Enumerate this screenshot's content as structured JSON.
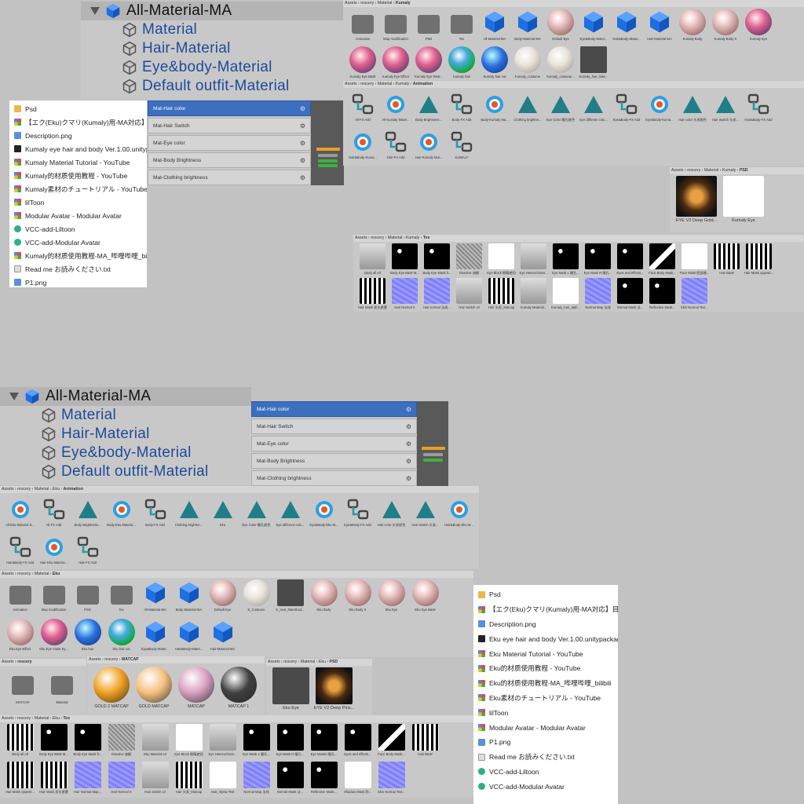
{
  "top_hierarchy": {
    "root": "All-Material-MA",
    "children": [
      "Material",
      "Hair-Material",
      "Eye&body-Material",
      "Default outfit-Material"
    ]
  },
  "bottom_hierarchy": {
    "root": "All-Material-MA",
    "children": [
      "Material",
      "Hair-Material",
      "Eye&body-Material",
      "Default outfit-Material"
    ]
  },
  "top_animator": {
    "params": [
      "Mat-Hair color",
      "Mat-Hair Switch",
      "Mat-Eye color",
      "Mat-Body Brightness",
      "Mat-Clothing brightness"
    ]
  },
  "bottom_animator": {
    "params": [
      "Mat-Hair color",
      "Mat-Hair Switch",
      "Mat-Eye color",
      "Mat-Body Brightness",
      "Mat-Clothing brightness"
    ]
  },
  "top_files": {
    "items": [
      {
        "icon": "folder",
        "label": "Psd"
      },
      {
        "icon": "web",
        "label": "【エク(Eku)クマリ(Kumaly)用-MA対応】目・..."
      },
      {
        "icon": "img",
        "label": "Description.png"
      },
      {
        "icon": "pkg",
        "label": "Kumaly eye hair and body Ver.1.00.unitypa..."
      },
      {
        "icon": "web",
        "label": "Kumaly Material Tutorial - YouTube"
      },
      {
        "icon": "web",
        "label": "Kumaly的材质使用教程 - YouTube"
      },
      {
        "icon": "web",
        "label": "Kumaly素材のチュートリアル - YouTube"
      },
      {
        "icon": "web",
        "label": "lilToon"
      },
      {
        "icon": "web",
        "label": "Modular Avatar - Modular Avatar"
      },
      {
        "icon": "vcc",
        "label": "VCC-add-Liltoon"
      },
      {
        "icon": "vcc",
        "label": "VCC-add-Modular Avatar"
      },
      {
        "icon": "web",
        "label": "Kumaly的材质使用教程-MA_哔哩哔哩_bilibili"
      },
      {
        "icon": "txt",
        "label": "Read me お読みください.txt"
      },
      {
        "icon": "img",
        "label": "P1.png"
      }
    ]
  },
  "bottom_files": {
    "items": [
      {
        "icon": "folder",
        "label": "Psd"
      },
      {
        "icon": "web",
        "label": "【エク(Eku)クマリ(Kumaly)用-MA対応】目・"
      },
      {
        "icon": "img",
        "label": "Description.png"
      },
      {
        "icon": "pkg",
        "label": "Eku eye hair and body Ver.1.00.unitypackag"
      },
      {
        "icon": "web",
        "label": "Eku Material Tutorial - YouTube"
      },
      {
        "icon": "web",
        "label": "Eku的材质使用教程 - YouTube"
      },
      {
        "icon": "web",
        "label": "Eku的材质使用教程-MA_哔哩哔哩_bilibili"
      },
      {
        "icon": "web",
        "label": "Eku素材のチュートリアル - YouTube"
      },
      {
        "icon": "web",
        "label": "lilToon"
      },
      {
        "icon": "web",
        "label": "Modular Avatar - Modular Avatar"
      },
      {
        "icon": "img",
        "label": "P1.png"
      },
      {
        "icon": "txt",
        "label": "Read me お読みください.txt"
      },
      {
        "icon": "vcc",
        "label": "VCC-add-Liltoon"
      },
      {
        "icon": "vcc",
        "label": "VCC-add-Modular Avatar"
      }
    ]
  },
  "kumaly_panel": {
    "path": [
      "Assets",
      "rescery",
      "Material"
    ],
    "current": "Kumaly",
    "items": [
      {
        "t": "folder",
        "c": "Animation"
      },
      {
        "t": "folder",
        "c": "Map modification"
      },
      {
        "t": "folder",
        "c": "PSD"
      },
      {
        "t": "folder",
        "c": "Tex"
      },
      {
        "t": "cube",
        "c": "All-Material-MA"
      },
      {
        "t": "cube",
        "c": "Body-Material-MA"
      },
      {
        "t": "ball",
        "c": "Default Eye"
      },
      {
        "t": "cube",
        "c": "Eye&Body-Mater..."
      },
      {
        "t": "cube",
        "c": "Hair&Body-Mater..."
      },
      {
        "t": "cube",
        "c": "Hair-Material-MA"
      },
      {
        "t": "ball",
        "c": "Kumaly Body"
      },
      {
        "t": "ball",
        "c": "Kumaly Body X"
      },
      {
        "t": "ballp",
        "c": "Kumaly Eye"
      },
      {
        "t": "ballp",
        "c": "Kumaly Eye B&W"
      },
      {
        "t": "ballp",
        "c": "Kumaly Eye Effect"
      },
      {
        "t": "ballp",
        "c": "Kumaly Eye Redr..."
      },
      {
        "t": "ballc",
        "c": "Kumaly hair"
      },
      {
        "t": "ballb",
        "c": "Kumaly hair cut"
      },
      {
        "t": "ballw",
        "c": "Kumaly_costume"
      },
      {
        "t": "ballw",
        "c": "Kumaly_costume..."
      },
      {
        "t": "gray",
        "c": "Kumaly_hair_fake..."
      }
    ]
  },
  "kumaly_anim": {
    "path": [
      "Assets",
      "rescery",
      "Material",
      "Kumaly"
    ],
    "current": "Animation",
    "items": [
      {
        "t": "state",
        "c": "All-FX Add"
      },
      {
        "t": "clip",
        "c": "All-Kumaly Mater..."
      },
      {
        "t": "tri",
        "c": "Body Brightness..."
      },
      {
        "t": "state",
        "c": "Body-FX Add"
      },
      {
        "t": "clip",
        "c": "Body-Kumaly Ma..."
      },
      {
        "t": "tri",
        "c": "Clothing brightne..."
      },
      {
        "t": "tri",
        "c": "Eye Color 瞳孔颜色"
      },
      {
        "t": "tri",
        "c": "Eye different colo..."
      },
      {
        "t": "state",
        "c": "Eye&Body-FX Add"
      },
      {
        "t": "clip",
        "c": "Eye&Body-Kuma..."
      },
      {
        "t": "tri",
        "c": "Hair color 头发颜色"
      },
      {
        "t": "tri",
        "c": "Hair Switch 头发..."
      },
      {
        "t": "state",
        "c": "Hair&Body-FX Add"
      },
      {
        "t": "clip",
        "c": "Hair&Body-Kuma..."
      },
      {
        "t": "state",
        "c": "Hair-FX Add"
      },
      {
        "t": "clip",
        "c": "Hair-Kumaly Mat..."
      },
      {
        "t": "state",
        "c": "KUMALY"
      }
    ]
  },
  "kumaly_psd": {
    "path": [
      "Assets",
      "rescery",
      "Material",
      "Kumaly"
    ],
    "current": "PSD",
    "items": [
      {
        "t": "eye",
        "c": "EYE V2 Deep Gold..."
      },
      {
        "t": "white",
        "c": "Kumaly Eye"
      }
    ]
  },
  "kumaly_tex": {
    "path": [
      "Assets",
      "rescery",
      "Material",
      "Kumaly"
    ],
    "current": "Tex",
    "items": [
      {
        "t": "char",
        "c": "Body all All"
      },
      {
        "t": "black",
        "c": "Body Eye B&W M..."
      },
      {
        "t": "black",
        "c": "Body Eye Mask fr..."
      },
      {
        "t": "noise",
        "c": "Dissolve 溶解"
      },
      {
        "t": "white",
        "c": "Eye Block 眼睛遮挡"
      },
      {
        "t": "char",
        "c": "Eye Heterochrom..."
      },
      {
        "t": "black",
        "c": "Eye Mask L 瞳孔..."
      },
      {
        "t": "black",
        "c": "Eye Mask R 瞳孔..."
      },
      {
        "t": "black",
        "c": "Eyes and effects..."
      },
      {
        "t": "mask",
        "c": "Face Body Mask..."
      },
      {
        "t": "white",
        "c": "Face Mask 脸部遮..."
      },
      {
        "t": "bw",
        "c": "Hair B&W"
      },
      {
        "t": "bw",
        "c": "Hair Mask opposit..."
      },
      {
        "t": "bw",
        "c": "Hair Mask 发光遮罩"
      },
      {
        "t": "normal",
        "c": "Hair Normal X"
      },
      {
        "t": "normal",
        "c": "Hair normal 法线..."
      },
      {
        "t": "char",
        "c": "Hair Switch UI"
      },
      {
        "t": "bw",
        "c": "Hair 头发_Matcap"
      },
      {
        "t": "char",
        "c": "Kumaly Material..."
      },
      {
        "t": "white",
        "c": "Kumaly_hair_alph..."
      },
      {
        "t": "normal",
        "c": "Normal Map 法线"
      },
      {
        "t": "black",
        "c": "Normal Mask 法..."
      },
      {
        "t": "black",
        "c": "Reflective Mask..."
      },
      {
        "t": "normal",
        "c": "Skin Normal Text..."
      }
    ]
  },
  "eku_anim": {
    "path": [
      "Assets",
      "rescery",
      "Material",
      "Eku"
    ],
    "current": "Animation",
    "items": [
      {
        "t": "clip",
        "c": "All-Eku Material S..."
      },
      {
        "t": "state",
        "c": "All-FX Add"
      },
      {
        "t": "tri",
        "c": "Body Brightness..."
      },
      {
        "t": "clip",
        "c": "Body-Eku Materia..."
      },
      {
        "t": "state",
        "c": "Body-FX Add"
      },
      {
        "t": "tri",
        "c": "Clothing brightne..."
      },
      {
        "t": "tri",
        "c": "Eku"
      },
      {
        "t": "tri",
        "c": "Eye Color 瞳孔颜色"
      },
      {
        "t": "tri",
        "c": "Eye different colo..."
      },
      {
        "t": "clip",
        "c": "Eye&Body-Eku M..."
      },
      {
        "t": "state",
        "c": "Eye&Body-FX Add"
      },
      {
        "t": "tri",
        "c": "Hair color 头发颜色"
      },
      {
        "t": "tri",
        "c": "Hair Switch 头发..."
      },
      {
        "t": "clip",
        "c": "Hair&Body-Eku M..."
      },
      {
        "t": "state",
        "c": "Hair&Body-FX Add"
      },
      {
        "t": "clip",
        "c": "Hair-Eku Materia..."
      },
      {
        "t": "state",
        "c": "Hair-FX Add"
      }
    ]
  },
  "eku_panel": {
    "path": [
      "Assets",
      "rescery",
      "Material"
    ],
    "current": "Eku",
    "items": [
      {
        "t": "folder",
        "c": "Animation"
      },
      {
        "t": "folder",
        "c": "Map modification"
      },
      {
        "t": "folder",
        "c": "PSD"
      },
      {
        "t": "folder",
        "c": "Tex"
      },
      {
        "t": "cube",
        "c": "All-Material-MA"
      },
      {
        "t": "cube",
        "c": "Body-Material-MA"
      },
      {
        "t": "ball",
        "c": "Default Eye"
      },
      {
        "t": "ballw",
        "c": "E_Costume"
      },
      {
        "t": "gray",
        "c": "E_Hair_fakeShad..."
      },
      {
        "t": "ball",
        "c": "Eku Body"
      },
      {
        "t": "ball",
        "c": "Eku Body X"
      },
      {
        "t": "ball",
        "c": "Eku Eye"
      },
      {
        "t": "ball",
        "c": "Eku Eye B&W"
      },
      {
        "t": "ball",
        "c": "Eku Eye Effect"
      },
      {
        "t": "ballp",
        "c": "Eku Eye Violet Ey..."
      },
      {
        "t": "ballb",
        "c": "Eku hair"
      },
      {
        "t": "ballc",
        "c": "Eku hair cut"
      },
      {
        "t": "cube",
        "c": "Eye&Body-Mater..."
      },
      {
        "t": "cube",
        "c": "Hair&Body-Mater..."
      },
      {
        "t": "cube",
        "c": "Hair-Material-MA"
      }
    ]
  },
  "rescery_panel": {
    "path": [
      "Assets"
    ],
    "current": "rescery",
    "items": [
      {
        "t": "folder",
        "c": "MATCAP"
      },
      {
        "t": "folder",
        "c": "Material"
      }
    ]
  },
  "matcap_panel": {
    "path": [
      "Assets",
      "rescery"
    ],
    "current": "MATCAP",
    "items": [
      {
        "c": "GOLD 2 MATCAP",
        "color": "#f0a020"
      },
      {
        "c": "GOLD MATCAP",
        "color": "#f4c080"
      },
      {
        "c": "MATCAP",
        "color": "#d8a0c0"
      },
      {
        "c": "MATCAP 1",
        "color": "#404040"
      }
    ]
  },
  "eku_psd": {
    "path": [
      "Assets",
      "rescery",
      "Material",
      "Eku"
    ],
    "current": "PSD",
    "items": [
      {
        "t": "gray",
        "c": "Eku Eye"
      },
      {
        "t": "eye",
        "c": "EYE V2 Deep Pinx..."
      }
    ]
  },
  "eku_tex": {
    "path": [
      "Assets",
      "rescery",
      "Material",
      "Eku"
    ],
    "current": "Tex",
    "items": [
      {
        "t": "bw",
        "c": "Body all All"
      },
      {
        "t": "black",
        "c": "Body Eye B&W M..."
      },
      {
        "t": "black",
        "c": "Body Eye Mask fr..."
      },
      {
        "t": "noise",
        "c": "Dissolve 溶解"
      },
      {
        "t": "char",
        "c": "Eku Material UI"
      },
      {
        "t": "white",
        "c": "Eye Block 眼睛遮挡"
      },
      {
        "t": "char",
        "c": "Eye Heterochrom..."
      },
      {
        "t": "black",
        "c": "Eye Mask L 瞳孔..."
      },
      {
        "t": "black",
        "c": "Eye Mask R 瞳孔..."
      },
      {
        "t": "black",
        "c": "Eye Mask2 瞳孔..."
      },
      {
        "t": "black",
        "c": "Eyes and effects..."
      },
      {
        "t": "mask",
        "c": "Face Body Mask..."
      },
      {
        "t": "bw",
        "c": "Hair B&W"
      },
      {
        "t": "bw",
        "c": "Hair Mask opposit..."
      },
      {
        "t": "bw",
        "c": "Hair Mask 发光遮罩"
      },
      {
        "t": "normal",
        "c": "Hair Normal Map..."
      },
      {
        "t": "normal",
        "c": "Hair Normal X"
      },
      {
        "t": "char",
        "c": "Hair Switch UI"
      },
      {
        "t": "bw",
        "c": "Hair 头发_Matcap"
      },
      {
        "t": "white",
        "c": "Hair_Alpha-Test"
      },
      {
        "t": "normal",
        "c": "Normal Map 法线"
      },
      {
        "t": "black",
        "c": "Normal Mask 法..."
      },
      {
        "t": "black",
        "c": "Reflective Mask..."
      },
      {
        "t": "white",
        "c": "Shadow Mask 阴..."
      },
      {
        "t": "normal",
        "c": "Skin Normal Text..."
      }
    ]
  }
}
